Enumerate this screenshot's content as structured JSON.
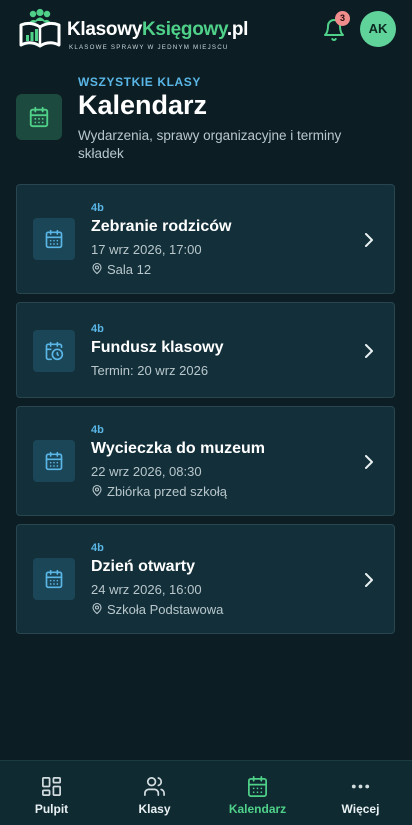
{
  "header": {
    "brand_part1": "Klasowy",
    "brand_part2": "Księgowy",
    "brand_part3": ".pl",
    "tagline": "KLASOWE SPRAWY W JEDNYM MIEJSCU",
    "notifications_count": "3",
    "avatar_initials": "AK"
  },
  "page": {
    "overline": "WSZYSTKIE KLASY",
    "title": "Kalendarz",
    "description": "Wydarzenia, sprawy organizacyjne i terminy składek"
  },
  "events": [
    {
      "class": "4b",
      "title": "Zebranie rodziców",
      "date": "17 wrz 2026, 17:00",
      "location": "Sala 12",
      "icon": "calendar-icon"
    },
    {
      "class": "4b",
      "title": "Fundusz klasowy",
      "date": "Termin: 20 wrz 2026",
      "icon": "calendar-clock-icon"
    },
    {
      "class": "4b",
      "title": "Wycieczka do muzeum",
      "date": "22 wrz 2026, 08:30",
      "location": "Zbiórka przed szkołą",
      "icon": "calendar-icon"
    },
    {
      "class": "4b",
      "title": "Dzień otwarty",
      "date": "24 wrz 2026, 16:00",
      "location": "Szkoła Podstawowa",
      "icon": "calendar-icon"
    }
  ],
  "nav": {
    "items": [
      {
        "label": "Pulpit",
        "icon": "dashboard-icon"
      },
      {
        "label": "Klasy",
        "icon": "users-icon"
      },
      {
        "label": "Kalendarz",
        "icon": "calendar-icon",
        "active": true
      },
      {
        "label": "Więcej",
        "icon": "more-icon"
      }
    ]
  },
  "colors": {
    "background": "#0c1e24",
    "accent_green": "#4fd189",
    "accent_blue": "#5ab6e6",
    "card": "#13303a",
    "badge": "#f08c8c"
  }
}
